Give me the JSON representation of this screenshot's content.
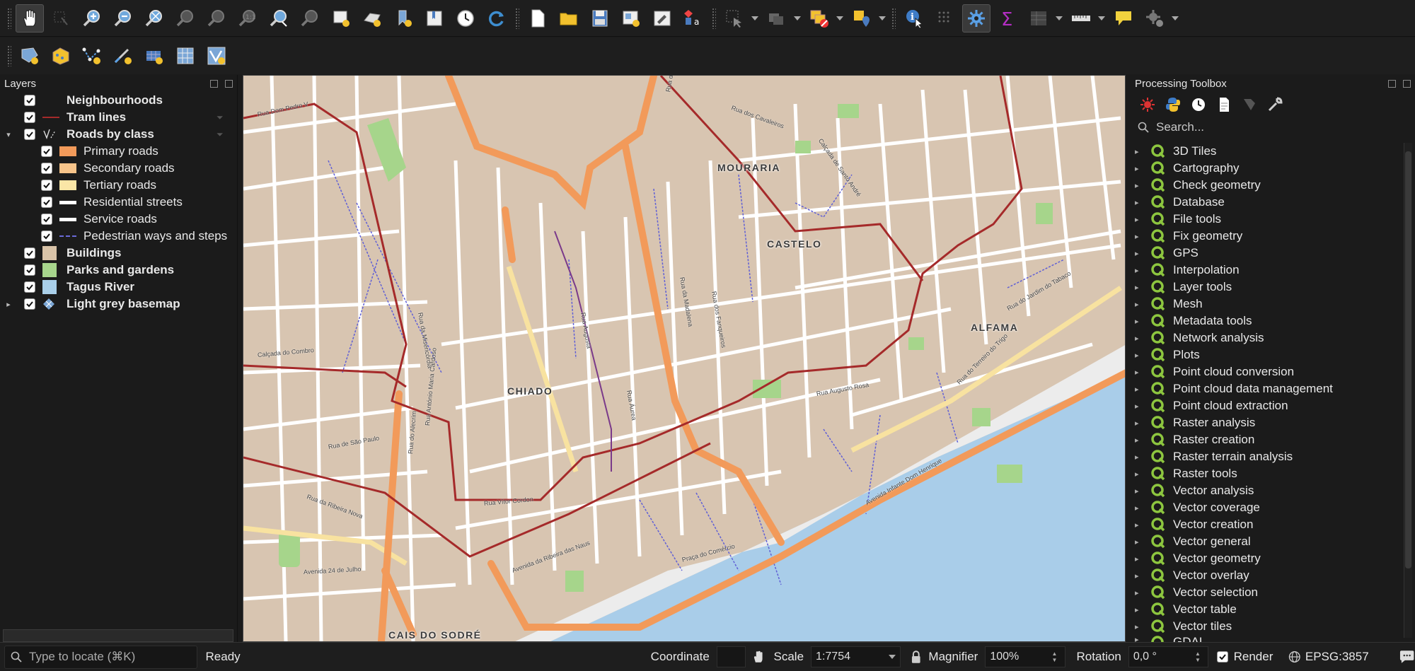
{
  "layers_panel": {
    "title": "Layers",
    "items": [
      {
        "label": "Neighbourhoods",
        "bold": true,
        "checked": true,
        "indent": 0
      },
      {
        "label": "Tram lines",
        "bold": true,
        "checked": true,
        "indent": 0
      },
      {
        "label": "Roads by class",
        "bold": true,
        "checked": true,
        "indent": 0,
        "expanded": true
      },
      {
        "label": "Primary roads",
        "bold": false,
        "checked": true,
        "indent": 1,
        "color": "#f29a5a"
      },
      {
        "label": "Secondary roads",
        "bold": false,
        "checked": true,
        "indent": 1,
        "color": "#f7c48a"
      },
      {
        "label": "Tertiary roads",
        "bold": false,
        "checked": true,
        "indent": 1,
        "color": "#fae6a6"
      },
      {
        "label": "Residential streets",
        "bold": false,
        "checked": true,
        "indent": 1,
        "color": "#ffffff"
      },
      {
        "label": "Service roads",
        "bold": false,
        "checked": true,
        "indent": 1,
        "color": "#ffffff"
      },
      {
        "label": "Pedestrian ways and steps",
        "bold": false,
        "checked": true,
        "indent": 1,
        "color": "#6a6ad8"
      },
      {
        "label": "Buildings",
        "bold": true,
        "checked": true,
        "indent": 0,
        "color": "#d9c3a8"
      },
      {
        "label": "Parks and gardens",
        "bold": true,
        "checked": true,
        "indent": 0,
        "color": "#a7d58c"
      },
      {
        "label": "Tagus River",
        "bold": true,
        "checked": true,
        "indent": 0,
        "color": "#a9cfe9"
      },
      {
        "label": "Light grey basemap",
        "bold": true,
        "checked": true,
        "indent": 0
      }
    ]
  },
  "map": {
    "district_labels": [
      "MOURARIA",
      "CASTELO",
      "ALFAMA",
      "CHIADO",
      "CAIS DO SODRÉ"
    ],
    "street_labels": [
      "Rua Dom Pedro V",
      "Rua dos Cavaleiros",
      "Calçada de Santo André",
      "Rua da Palma",
      "Calçada do Combro",
      "Rua da Misericórdia",
      "Rua Augusta",
      "Rua Áurea",
      "Rua da Madalena",
      "Rua dos Fanqueiros",
      "Rua Augusto Rosa",
      "Rua do Jardim do Tabaco",
      "Rua do Terreiro do Trigo",
      "Rua de São Paulo",
      "Rua da Ribeira Nova",
      "Avenida 24 de Julho",
      "Rua do Alecrim",
      "Rua António Maria Cardoso",
      "Rua Vítor Cordon",
      "Praça do Comércio",
      "Avenida da Ribeira das Naus",
      "Avenida Infante Dom Henrique"
    ],
    "colors": {
      "building": "#d8c5b1",
      "water": "#a9cde9",
      "park": "#a6d58b",
      "primary": "#f29a5a",
      "tertiary": "#f8e2a0",
      "tram": "#a52a2a",
      "pedestrian": "#5f5fd6"
    }
  },
  "toolbox": {
    "title": "Processing Toolbox",
    "search_placeholder": "Search...",
    "items": [
      "3D Tiles",
      "Cartography",
      "Check geometry",
      "Database",
      "File tools",
      "Fix geometry",
      "GPS",
      "Interpolation",
      "Layer tools",
      "Mesh",
      "Metadata tools",
      "Network analysis",
      "Plots",
      "Point cloud conversion",
      "Point cloud data management",
      "Point cloud extraction",
      "Raster analysis",
      "Raster creation",
      "Raster terrain analysis",
      "Raster tools",
      "Vector analysis",
      "Vector coverage",
      "Vector creation",
      "Vector general",
      "Vector geometry",
      "Vector overlay",
      "Vector selection",
      "Vector table",
      "Vector tiles",
      "GDAL"
    ]
  },
  "status_bar": {
    "locator_placeholder": "Type to locate (⌘K)",
    "state": "Ready",
    "coordinate_label": "Coordinate",
    "coordinate_value": "",
    "scale_label": "Scale",
    "scale_value": "1:7754",
    "magnifier_label": "Magnifier",
    "magnifier_value": "100%",
    "rotation_label": "Rotation",
    "rotation_value": "0,0 °",
    "render_label": "Render",
    "render_checked": true,
    "crs": "EPSG:3857"
  },
  "toolbar_icons": [
    "pan-icon",
    "pan-to-selection-icon",
    "zoom-in-icon",
    "zoom-out-icon",
    "zoom-full-icon",
    "zoom-to-selection-icon",
    "zoom-to-layer-icon",
    "zoom-native-icon",
    "zoom-last-icon",
    "zoom-next-icon",
    "new-map-view-icon",
    "new-3d-view-icon",
    "new-bookmark-icon",
    "show-bookmarks-icon",
    "temporal-controller-icon",
    "refresh-icon",
    "new-project-icon",
    "open-project-icon",
    "save-project-icon",
    "layout-manager-icon",
    "style-manager-icon",
    "labels-icon",
    "select-features-icon",
    "select-by-value-icon",
    "deselect-icon",
    "identify-icon",
    "attribute-table-icon",
    "processing-toolbox-icon",
    "statistics-icon",
    "open-field-calculator-icon",
    "measure-icon",
    "map-tips-icon",
    "plugins-icon"
  ]
}
